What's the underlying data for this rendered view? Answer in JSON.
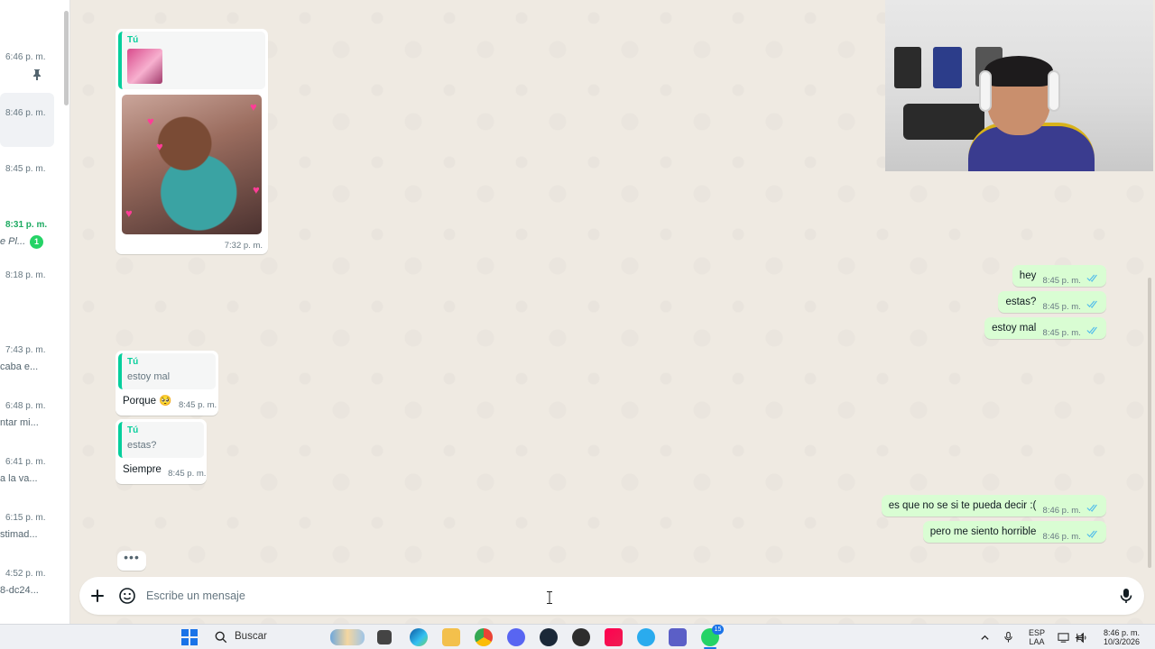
{
  "sidebar": {
    "chats": [
      {
        "time": "6:46 p. m.",
        "snippet": "",
        "pinned": true,
        "active": false,
        "unread": false
      },
      {
        "time": "8:46 p. m.",
        "snippet": "",
        "pinned": false,
        "active": true,
        "unread": false
      },
      {
        "time": "8:45 p. m.",
        "snippet": "",
        "pinned": false,
        "active": false,
        "unread": false
      },
      {
        "time": "8:31 p. m.",
        "snippet": "e Pl...",
        "pinned": false,
        "active": false,
        "unread": true,
        "unread_count": "1"
      },
      {
        "time": "8:18 p. m.",
        "snippet": "",
        "pinned": false,
        "active": false,
        "unread": false
      },
      {
        "time": "7:43 p. m.",
        "snippet": "caba e...",
        "pinned": false,
        "active": false,
        "unread": false
      },
      {
        "time": "6:48 p. m.",
        "snippet": "ntar mi...",
        "pinned": false,
        "active": false,
        "unread": false
      },
      {
        "time": "6:41 p. m.",
        "snippet": "a la va...",
        "pinned": false,
        "active": false,
        "unread": false
      },
      {
        "time": "6:15 p. m.",
        "snippet": "stimad...",
        "pinned": false,
        "active": false,
        "unread": false
      },
      {
        "time": "4:52 p. m.",
        "snippet": "8-dc24...",
        "pinned": false,
        "active": false,
        "unread": false
      }
    ]
  },
  "messages": {
    "incoming_image": {
      "quote_author": "Tú",
      "time": "7:32 p. m."
    },
    "outgoing_1": [
      {
        "text": "hey",
        "time": "8:45 p. m."
      },
      {
        "text": "estas?",
        "time": "8:45 p. m."
      },
      {
        "text": "estoy mal",
        "time": "8:45 p. m."
      }
    ],
    "incoming_replies": [
      {
        "quote_author": "Tú",
        "quote_text": "estoy mal",
        "text": "Porque 🥺",
        "time": "8:45 p. m."
      },
      {
        "quote_author": "Tú",
        "quote_text": "estas?",
        "text": "Siempre",
        "time": "8:45 p. m."
      }
    ],
    "outgoing_2": [
      {
        "text": "es que no se si te pueda decir :(",
        "time": "8:46 p. m."
      },
      {
        "text": "pero me siento horrible",
        "time": "8:46 p. m."
      }
    ],
    "typing_indicator": "•••"
  },
  "composer": {
    "placeholder": "Escribe un mensaje",
    "add_icon": "plus-icon",
    "sticker_icon": "sticker-icon",
    "mic_icon": "microphone-icon"
  },
  "taskbar": {
    "search_label": "Buscar",
    "language": "ESP",
    "layout": "LAA",
    "clock_time": "8:46 p. m.",
    "clock_date": "10/3/2026",
    "whatsapp_badge": "15"
  },
  "colors": {
    "accent_green": "#06cf9c",
    "outgoing_bubble": "#d9fdd3",
    "chat_background": "#efeae2",
    "read_ticks": "#53bdeb"
  }
}
